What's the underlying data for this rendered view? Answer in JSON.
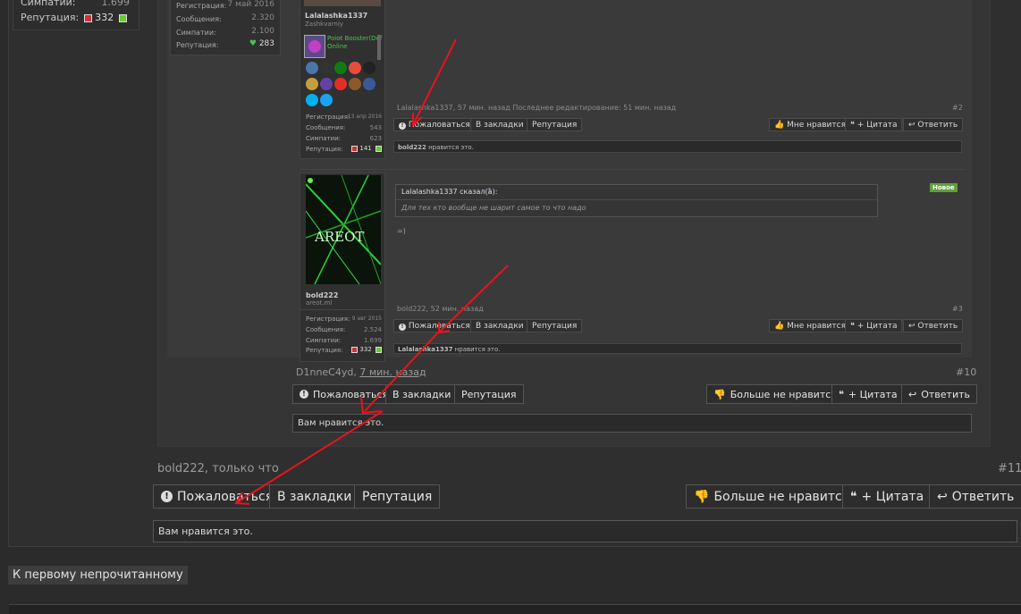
{
  "sidebar_user": {
    "sympathy_label": "Симпатии:",
    "sympathy_value": "1.699",
    "reputation_label": "Репутация:",
    "reputation_value": "332"
  },
  "quoted_post_2": {
    "stats": [
      {
        "label": "Регистрация:",
        "value": "7 май 2016"
      },
      {
        "label": "Сообщения:",
        "value": "2.320"
      },
      {
        "label": "Симпатии:",
        "value": "2.100"
      },
      {
        "label": "Репутация:",
        "value": "283"
      }
    ],
    "username": "Lalalashka1337",
    "user_title": "Zashkvarniy",
    "booster_name": "Poiot Booster(Def",
    "booster_status": "Online",
    "stats2": [
      {
        "label": "Регистрация:",
        "value": "13 апр 2016"
      },
      {
        "label": "Сообщения:",
        "value": "543"
      },
      {
        "label": "Симпатии:",
        "value": "623"
      },
      {
        "label": "Репутация:",
        "value": "141"
      }
    ],
    "meta": "Lalalashka1337, 57 мин. назад Последнее редактирование: 51 мин. назад",
    "post_number": "#2",
    "buttons": {
      "report": "Пожаловаться",
      "bookmark": "В закладки",
      "reputation": "Репутация",
      "dislike": "Мне нравится",
      "quote": "+ Цитата",
      "reply": "Ответить"
    },
    "likes_user": "bold222",
    "likes_text": " нравится это."
  },
  "quoted_post_3": {
    "quote_author": "Lalalashka1337 сказал(а):",
    "quote_text": "Для тех кто вообще не шарит самое то что надо",
    "new_badge": "Новое",
    "body": "=)",
    "avatar_text": "AREOT",
    "username": "bold222",
    "user_title": "areot.ml",
    "stats": [
      {
        "label": "Регистрация:",
        "value": "9 авг 2015"
      },
      {
        "label": "Сообщения:",
        "value": "2.524"
      },
      {
        "label": "Симпатии:",
        "value": "1.699"
      },
      {
        "label": "Репутация:",
        "value": "332"
      }
    ],
    "meta": "bold222, 52 мин. назад",
    "post_number": "#3",
    "buttons": {
      "report": "Пожаловаться",
      "bookmark": "В закладки",
      "reputation": "Репутация",
      "dislike": "Мне нравится",
      "quote": "+ Цитата",
      "reply": "Ответить"
    },
    "likes_user": "Lalalashka1337",
    "likes_text": " нравится это."
  },
  "post_10": {
    "author": "D1nneC4yd",
    "time": "7 мин. назад",
    "post_number": "#10",
    "buttons": {
      "report": "Пожаловаться",
      "bookmark": "В закладки",
      "reputation": "Репутация",
      "dislike": "Больше не нравится",
      "quote": "+ Цитата",
      "reply": "Ответить"
    },
    "likes_text": "Вам нравится это."
  },
  "post_11": {
    "meta": "bold222, только что",
    "post_number": "#11",
    "buttons": {
      "report": "Пожаловаться",
      "bookmark": "В закладки",
      "reputation": "Репутация",
      "dislike": "Больше не нравится",
      "quote": "+ Цитата",
      "reply": "Ответить"
    },
    "likes_text": "Вам нравится это."
  },
  "first_unread": "К первому непрочитанному",
  "colors": {
    "arrow": "#e8141c",
    "badge_new": "#5fa03c",
    "heart": "#4cc24c"
  }
}
